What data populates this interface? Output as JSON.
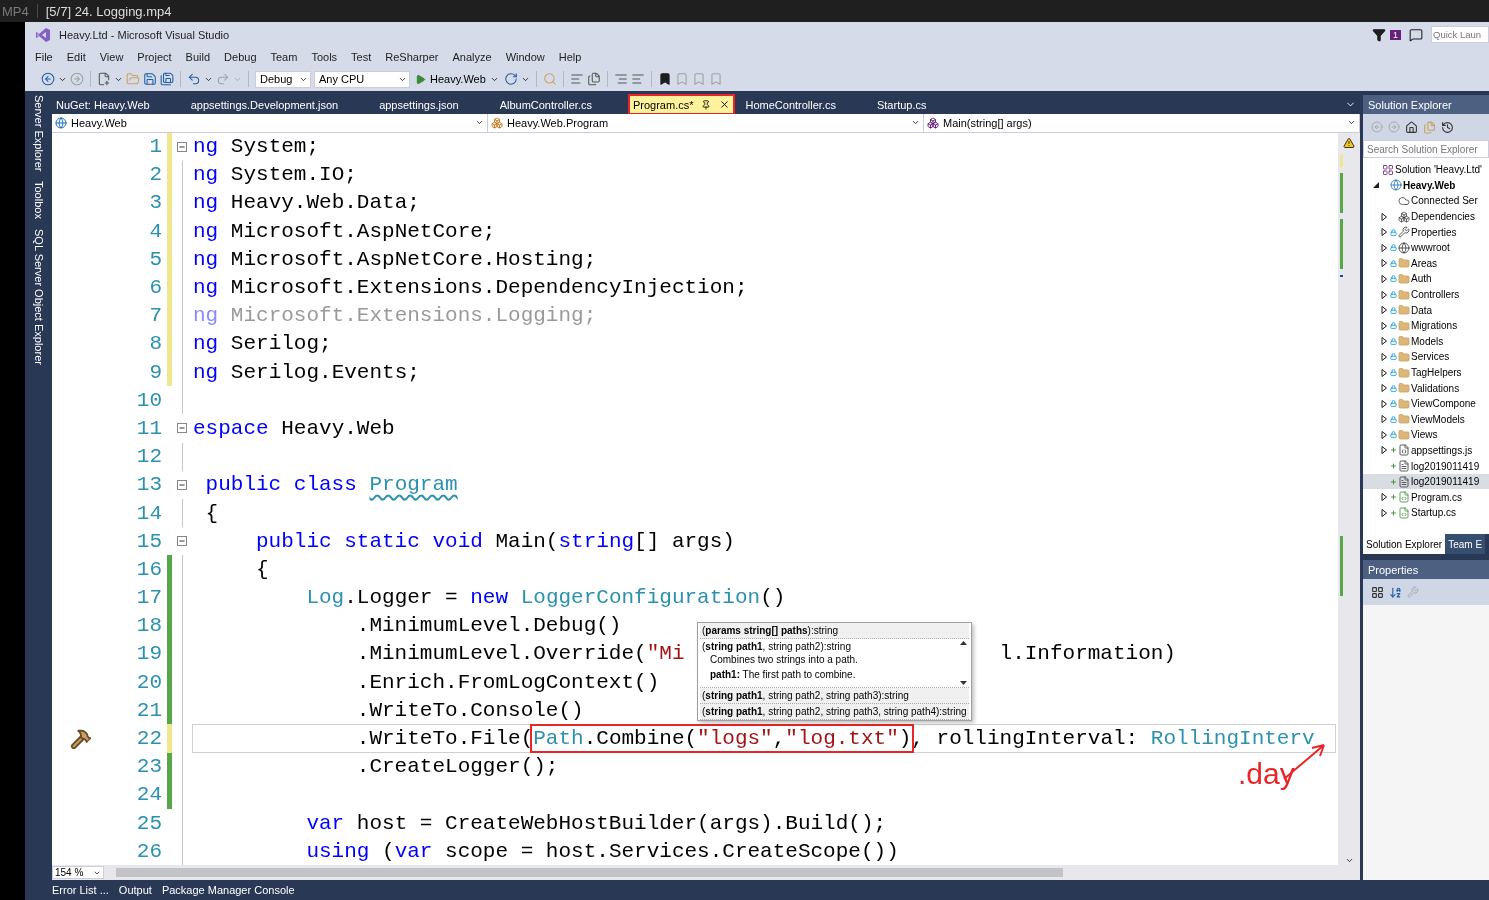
{
  "player": {
    "format": "MP4",
    "title": "[5/7] 24. Logging.mp4"
  },
  "window": {
    "title": "Heavy.Ltd - Microsoft Visual Studio",
    "notification_count": "1",
    "quick_launch": {
      "placeholder": "Quick Laun"
    }
  },
  "menu": [
    "File",
    "Edit",
    "View",
    "Project",
    "Build",
    "Debug",
    "Team",
    "Tools",
    "Test",
    "ReSharper",
    "Analyze",
    "Window",
    "Help"
  ],
  "toolbar": {
    "configuration": "Debug",
    "platform": "Any CPU",
    "start_target": "Heavy.Web"
  },
  "side_tabs": [
    "Server Explorer",
    "Toolbox",
    "SQL Server Object Explorer"
  ],
  "editor": {
    "tabs": [
      {
        "label": "NuGet: Heavy.Web",
        "selected": false,
        "annotated": false
      },
      {
        "label": "appsettings.Development.json",
        "selected": false,
        "annotated": false
      },
      {
        "label": "appsettings.json",
        "selected": false,
        "annotated": false
      },
      {
        "label": "AlbumController.cs",
        "selected": false,
        "annotated": false
      },
      {
        "label": "Program.cs*",
        "selected": true,
        "annotated": true
      },
      {
        "label": "HomeController.cs",
        "selected": false,
        "annotated": false
      },
      {
        "label": "Startup.cs",
        "selected": false,
        "annotated": false
      }
    ],
    "navigation": [
      {
        "kind": "project",
        "label": "Heavy.Web"
      },
      {
        "kind": "class",
        "label": "Heavy.Web.Program"
      },
      {
        "kind": "method",
        "label": "Main(string[] args)"
      }
    ],
    "lines": [
      {
        "number": "1",
        "changed": true,
        "saved": false,
        "fold": true,
        "current": false,
        "tokens": [
          {
            "kind": "keyword",
            "text": "ng"
          },
          {
            "kind": "plain",
            "text": " System;"
          }
        ]
      },
      {
        "number": "2",
        "changed": true,
        "saved": false,
        "fold": false,
        "current": false,
        "tokens": [
          {
            "kind": "keyword",
            "text": "ng"
          },
          {
            "kind": "plain",
            "text": " System.IO;"
          }
        ]
      },
      {
        "number": "3",
        "changed": true,
        "saved": false,
        "fold": false,
        "current": false,
        "tokens": [
          {
            "kind": "keyword",
            "text": "ng"
          },
          {
            "kind": "plain",
            "text": " Heavy.Web.Data;"
          }
        ]
      },
      {
        "number": "4",
        "changed": true,
        "saved": false,
        "fold": false,
        "current": false,
        "tokens": [
          {
            "kind": "keyword",
            "text": "ng"
          },
          {
            "kind": "plain",
            "text": " Microsoft.AspNetCore;"
          }
        ]
      },
      {
        "number": "5",
        "changed": true,
        "saved": false,
        "fold": false,
        "current": false,
        "tokens": [
          {
            "kind": "keyword",
            "text": "ng"
          },
          {
            "kind": "plain",
            "text": " Microsoft.AspNetCore.Hosting;"
          }
        ]
      },
      {
        "number": "6",
        "changed": true,
        "saved": false,
        "fold": false,
        "current": false,
        "tokens": [
          {
            "kind": "keyword",
            "text": "ng"
          },
          {
            "kind": "plain",
            "text": " Microsoft.Extensions.DependencyInjection;"
          }
        ]
      },
      {
        "number": "7",
        "changed": true,
        "saved": false,
        "fold": false,
        "current": false,
        "tokens": [
          {
            "kind": "faded-keyword",
            "text": "ng"
          },
          {
            "kind": "faded",
            "text": " Microsoft.Extensions.Logging;"
          }
        ]
      },
      {
        "number": "8",
        "changed": true,
        "saved": false,
        "fold": false,
        "current": false,
        "tokens": [
          {
            "kind": "keyword",
            "text": "ng"
          },
          {
            "kind": "plain",
            "text": " Serilog;"
          }
        ]
      },
      {
        "number": "9",
        "changed": true,
        "saved": false,
        "fold": false,
        "current": false,
        "tokens": [
          {
            "kind": "keyword",
            "text": "ng"
          },
          {
            "kind": "plain",
            "text": " Serilog.Events;"
          }
        ]
      },
      {
        "number": "10",
        "changed": false,
        "fold": false,
        "current": false
      },
      {
        "number": "11",
        "changed": false,
        "fold": true,
        "current": false,
        "tokens": [
          {
            "kind": "keyword",
            "text": "espace"
          },
          {
            "kind": "plain",
            "text": " Heavy.Web"
          }
        ],
        "children": [
          {
            "number": "12",
            "changed": false,
            "fold": false,
            "current": false
          },
          {
            "number": "13",
            "changed": false,
            "fold": true,
            "current": false,
            "tokens": [
              {
                "kind": "keyword",
                "text": "public class "
              },
              {
                "kind": "type-squiggle",
                "text": "Program"
              }
            ]
          },
          {
            "number": "14",
            "changed": false,
            "fold": false,
            "current": false,
            "tokens": [
              {
                "kind": "plain",
                "text": "{"
              }
            ],
            "children": [
              {
                "number": "15",
                "changed": false,
                "fold": true,
                "current": false,
                "tokens": [
                  {
                    "kind": "keyword",
                    "text": "public static void"
                  },
                  {
                    "kind": "plain",
                    "text": " Main("
                  },
                  {
                    "kind": "keyword",
                    "text": "string"
                  },
                  {
                    "kind": "plain",
                    "text": "[] args)"
                  }
                ]
              },
              {
                "number": "16",
                "changed": true,
                "saved": true,
                "fold": false,
                "current": false,
                "tokens": [
                  {
                    "kind": "plain",
                    "text": "{"
                  }
                ],
                "children": [
                  {
                    "number": "17",
                    "changed": true,
                    "saved": true,
                    "fold": false,
                    "current": false,
                    "tokens": [
                      {
                        "kind": "type",
                        "text": "Log"
                      },
                      {
                        "kind": "plain",
                        "text": ".Logger = "
                      },
                      {
                        "kind": "keyword",
                        "text": "new "
                      },
                      {
                        "kind": "type",
                        "text": "LoggerConfiguration"
                      },
                      {
                        "kind": "plain",
                        "text": "()"
                      }
                    ],
                    "children": [
                      {
                        "number": "18",
                        "changed": true,
                        "saved": true,
                        "fold": false,
                        "current": false,
                        "tokens": [
                          {
                            "kind": "plain",
                            "text": ".MinimumLevel.Debug()"
                          }
                        ]
                      },
                      {
                        "number": "19",
                        "changed": true,
                        "saved": true,
                        "fold": false,
                        "current": false,
                        "tokens": [
                          {
                            "kind": "plain",
                            "text": ".MinimumLevel.Override("
                          },
                          {
                            "kind": "string",
                            "text": "\"Mi"
                          },
                          {
                            "kind": "covered"
                          },
                          {
                            "kind": "plain",
                            "text": "l.Information)"
                          }
                        ]
                      },
                      {
                        "number": "20",
                        "changed": true,
                        "saved": true,
                        "fold": false,
                        "current": false,
                        "tokens": [
                          {
                            "kind": "plain",
                            "text": ".Enrich.FromLogContext()"
                          }
                        ]
                      },
                      {
                        "number": "21",
                        "changed": true,
                        "saved": true,
                        "fold": false,
                        "current": false,
                        "tokens": [
                          {
                            "kind": "plain",
                            "text": ".WriteTo.Console()"
                          }
                        ]
                      },
                      {
                        "number": "22",
                        "changed": true,
                        "saved": false,
                        "fold": false,
                        "current": true,
                        "tokens": [
                          {
                            "kind": "plain",
                            "text": ".WriteTo.File("
                          },
                          {
                            "kind": "group",
                            "annotated": true,
                            "tokens": [
                              {
                                "kind": "type",
                                "text": "Path"
                              },
                              {
                                "kind": "plain",
                                "text": ".Combine("
                              },
                              {
                                "kind": "string",
                                "text": "\"logs\""
                              },
                              {
                                "kind": "plain",
                                "text": ","
                              },
                              {
                                "kind": "string",
                                "text": "\"log.txt\""
                              },
                              {
                                "kind": "plain",
                                "text": ")"
                              }
                            ]
                          },
                          {
                            "kind": "plain",
                            "text": ", rollingInterval: "
                          },
                          {
                            "kind": "type",
                            "text": "RollingInterv"
                          }
                        ]
                      },
                      {
                        "number": "23",
                        "changed": true,
                        "saved": true,
                        "fold": false,
                        "current": false,
                        "tokens": [
                          {
                            "kind": "plain",
                            "text": ".CreateLogger();"
                          }
                        ]
                      }
                    ]
                  },
                  {
                    "number": "24",
                    "changed": true,
                    "saved": true,
                    "fold": false,
                    "current": false
                  },
                  {
                    "number": "25",
                    "changed": false,
                    "fold": false,
                    "current": false,
                    "tokens": [
                      {
                        "kind": "keyword",
                        "text": "var"
                      },
                      {
                        "kind": "plain",
                        "text": " host = CreateWebHostBuilder(args).Build();"
                      }
                    ]
                  },
                  {
                    "number": "26",
                    "changed": false,
                    "fold": false,
                    "current": false,
                    "tokens": [
                      {
                        "kind": "keyword",
                        "text": "using"
                      },
                      {
                        "kind": "plain",
                        "text": " ("
                      },
                      {
                        "kind": "keyword",
                        "text": "var"
                      },
                      {
                        "kind": "plain",
                        "text": " scope = host.Services.CreateScope())"
                      }
                    ]
                  }
                ]
              }
            ]
          }
        ]
      }
    ],
    "tooltip": {
      "rows": [
        {
          "text": "(**params string[] paths**):string",
          "selected": false
        },
        {
          "text": "(**string path1**, string path2):string",
          "selected": true,
          "description": [
            "Combines two strings into a path.",
            "**path1:** The first path to combine."
          ]
        },
        {
          "text": "(**string path1**, string path2, string path3):string",
          "selected": false
        },
        {
          "text": "(**string path1**, string path2, string path3, string path4):string",
          "selected": false
        }
      ]
    },
    "annotation": {
      "text": ".day"
    },
    "zoom": "154 %"
  },
  "solution_explorer": {
    "title": "Solution Explorer",
    "search": {
      "placeholder": "Search Solution Explorer"
    },
    "tree": [
      {
        "label": "Solution 'Heavy.Ltd'",
        "kind": "solution",
        "expandable": false,
        "locked": false,
        "added": false,
        "selected": false,
        "children": [
          {
            "label": "Heavy.Web",
            "kind": "project",
            "expandable": true,
            "expanded": true,
            "locked": false,
            "added": false,
            "selected": false,
            "children": [
              {
                "label": "Connected Ser",
                "kind": "connected",
                "expandable": false,
                "locked": false,
                "added": false,
                "selected": false
              },
              {
                "label": "Dependencies",
                "kind": "dependencies",
                "expandable": true,
                "expanded": false,
                "locked": false,
                "added": false,
                "selected": false
              },
              {
                "label": "Properties",
                "kind": "properties",
                "expandable": true,
                "expanded": false,
                "locked": true,
                "added": false,
                "selected": false
              },
              {
                "label": "wwwroot",
                "kind": "web",
                "expandable": true,
                "expanded": false,
                "locked": true,
                "added": false,
                "selected": false
              },
              {
                "label": "Areas",
                "kind": "folder",
                "expandable": true,
                "expanded": false,
                "locked": true,
                "added": false,
                "selected": false
              },
              {
                "label": "Auth",
                "kind": "folder",
                "expandable": true,
                "expanded": false,
                "locked": true,
                "added": false,
                "selected": false
              },
              {
                "label": "Controllers",
                "kind": "folder",
                "expandable": true,
                "expanded": false,
                "locked": true,
                "added": false,
                "selected": false
              },
              {
                "label": "Data",
                "kind": "folder",
                "expandable": true,
                "expanded": false,
                "locked": true,
                "added": false,
                "selected": false
              },
              {
                "label": "Migrations",
                "kind": "folder",
                "expandable": true,
                "expanded": false,
                "locked": true,
                "added": false,
                "selected": false
              },
              {
                "label": "Models",
                "kind": "folder",
                "expandable": true,
                "expanded": false,
                "locked": true,
                "added": false,
                "selected": false
              },
              {
                "label": "Services",
                "kind": "folder",
                "expandable": true,
                "expanded": false,
                "locked": true,
                "added": false,
                "selected": false
              },
              {
                "label": "TagHelpers",
                "kind": "folder",
                "expandable": true,
                "expanded": false,
                "locked": true,
                "added": false,
                "selected": false
              },
              {
                "label": "Validations",
                "kind": "folder",
                "expandable": true,
                "expanded": false,
                "locked": true,
                "added": false,
                "selected": false
              },
              {
                "label": "ViewCompone",
                "kind": "folder",
                "expandable": true,
                "expanded": false,
                "locked": true,
                "added": false,
                "selected": false
              },
              {
                "label": "ViewModels",
                "kind": "folder",
                "expandable": true,
                "expanded": false,
                "locked": true,
                "added": false,
                "selected": false
              },
              {
                "label": "Views",
                "kind": "folder",
                "expandable": true,
                "expanded": false,
                "locked": true,
                "added": false,
                "selected": false
              },
              {
                "label": "appsettings.js",
                "kind": "json",
                "expandable": true,
                "expanded": false,
                "locked": false,
                "added": true,
                "selected": false
              },
              {
                "label": "log2019011419",
                "kind": "file",
                "expandable": false,
                "locked": false,
                "added": true,
                "selected": false
              },
              {
                "label": "log2019011419",
                "kind": "file",
                "expandable": false,
                "locked": false,
                "added": true,
                "selected": true
              },
              {
                "label": "Program.cs",
                "kind": "csharp",
                "expandable": true,
                "expanded": false,
                "locked": false,
                "added": true,
                "selected": false
              },
              {
                "label": "Startup.cs",
                "kind": "csharp",
                "expandable": true,
                "expanded": false,
                "locked": false,
                "added": true,
                "selected": false
              }
            ]
          }
        ]
      }
    ],
    "tabs": [
      {
        "label": "Solution Explorer",
        "selected": true
      },
      {
        "label": "Team E",
        "selected": false
      }
    ]
  },
  "properties": {
    "title": "Properties"
  },
  "bottom_tabs": [
    "Error List ...",
    "Output",
    "Package Manager Console"
  ]
}
